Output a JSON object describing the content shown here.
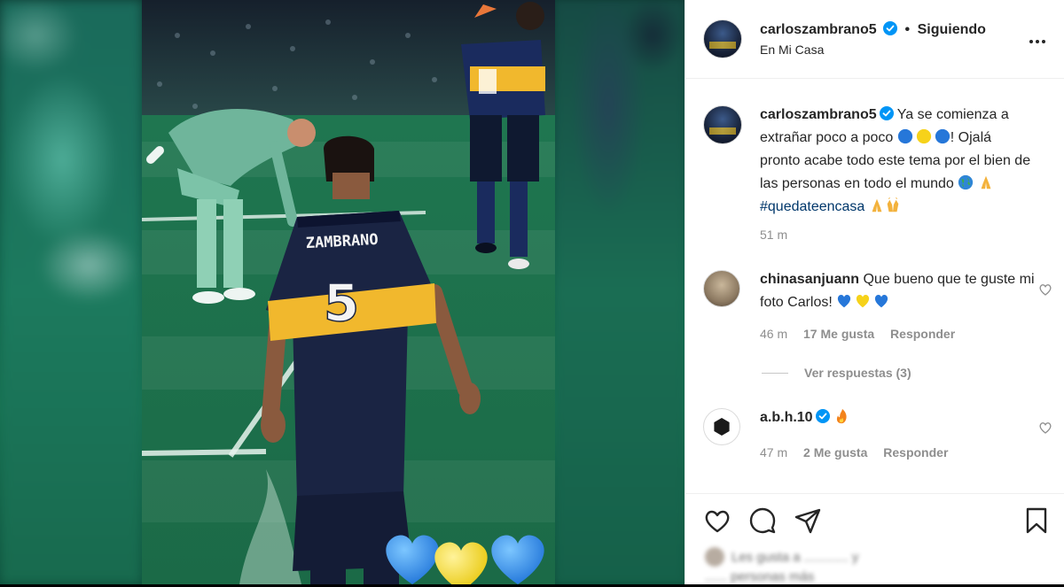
{
  "post": {
    "username": "carloszambrano5",
    "follow_status": "Siguiendo",
    "dot": "•",
    "location": "En Mi Casa"
  },
  "caption": {
    "username": "carloszambrano5",
    "text_part1": "Ya se comienza a extrañar poco a poco",
    "text_part2": "! Ojalá pronto acabe todo este tema por el bien de las personas en todo el mundo",
    "hashtag": "#quedateencasa",
    "time": "51 m"
  },
  "comments": [
    {
      "username": "chinasanjuann",
      "text": "Que bueno que te guste mi foto Carlos!",
      "time": "46 m",
      "likes": "17 Me gusta",
      "reply_label": "Responder",
      "view_replies": "Ver respuestas (3)"
    },
    {
      "username": "a.b.h.10",
      "text": "",
      "time": "47 m",
      "likes": "2 Me gusta",
      "reply_label": "Responder"
    }
  ],
  "actions": {
    "icons": [
      "heart-icon",
      "comment-icon",
      "share-icon",
      "bookmark-icon"
    ],
    "likes_summary_line1": "Les gusta a ............ y",
    "likes_summary_line2": "...... personas más"
  },
  "photo": {
    "jersey_name": "ZAMBRANO",
    "jersey_number": "5"
  },
  "colors": {
    "accent_blue": "#0095f6",
    "boca_blue": "#1a2b5e",
    "boca_yellow": "#f1b82d",
    "pitch_green": "#1f7a50"
  }
}
